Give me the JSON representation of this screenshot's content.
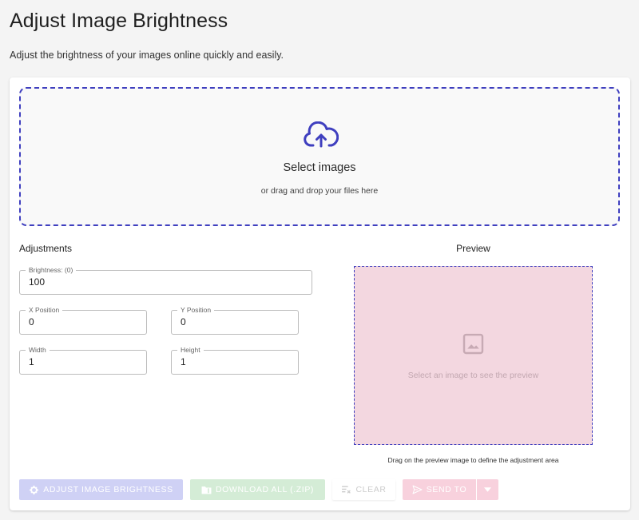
{
  "header": {
    "title": "Adjust Image Brightness",
    "subtitle": "Adjust the brightness of your images online quickly and easily."
  },
  "dropzone": {
    "title": "Select images",
    "subtitle": "or drag and drop your files here",
    "icon": "cloud-upload-icon"
  },
  "adjustments": {
    "title": "Adjustments",
    "brightness": {
      "label": "Brightness: (0)",
      "value": "100"
    },
    "x_position": {
      "label": "X Position",
      "value": "0"
    },
    "y_position": {
      "label": "Y Position",
      "value": "0"
    },
    "width": {
      "label": "Width",
      "value": "1"
    },
    "height": {
      "label": "Height",
      "value": "1"
    }
  },
  "preview": {
    "title": "Preview",
    "placeholder": "Select an image to see the preview",
    "hint": "Drag on the preview image to define the adjustment area",
    "icon": "image-icon"
  },
  "actions": {
    "adjust_label": "ADJUST IMAGE BRIGHTNESS",
    "download_label": "DOWNLOAD ALL (.ZIP)",
    "clear_label": "CLEAR",
    "send_label": "SEND TO"
  },
  "colors": {
    "accent": "#3f3fbf",
    "preview_bg": "#f3d7e0",
    "adjust_button": "#cfd1f5",
    "download_button": "#d4ecd6",
    "send_button": "#f8d1dd"
  }
}
